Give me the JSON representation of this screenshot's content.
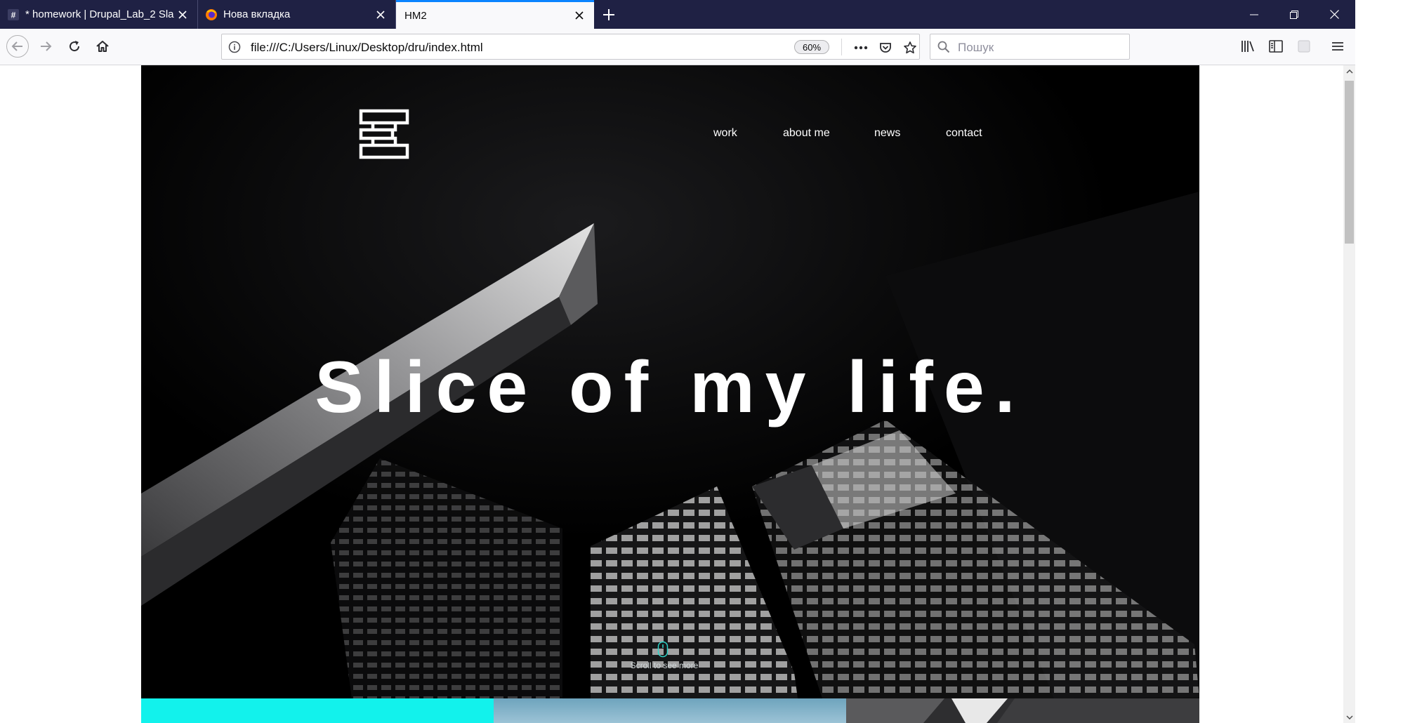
{
  "browser": {
    "tabs": [
      {
        "title": "* homework | Drupal_Lab_2 Sla",
        "icon": "hash-icon",
        "active": false
      },
      {
        "title": "Нова вкладка",
        "icon": "firefox-icon",
        "active": false
      },
      {
        "title": "HM2",
        "icon": "",
        "active": true
      }
    ],
    "url": "file:///C:/Users/Linux/Desktop/dru/index.html",
    "zoom": "60%",
    "search_placeholder": "Пошук"
  },
  "page": {
    "nav": [
      "work",
      "about me",
      "news",
      "contact"
    ],
    "headline": "Slice of my life.",
    "scroll_hint": "Scroll to see more"
  },
  "colors": {
    "tabstrip": "#1f2144",
    "accent_tab": "#0a84ff",
    "hero_bg": "#000000",
    "tile_cyan": "#12f2ec",
    "tile_sky": "#7fb0c8"
  }
}
